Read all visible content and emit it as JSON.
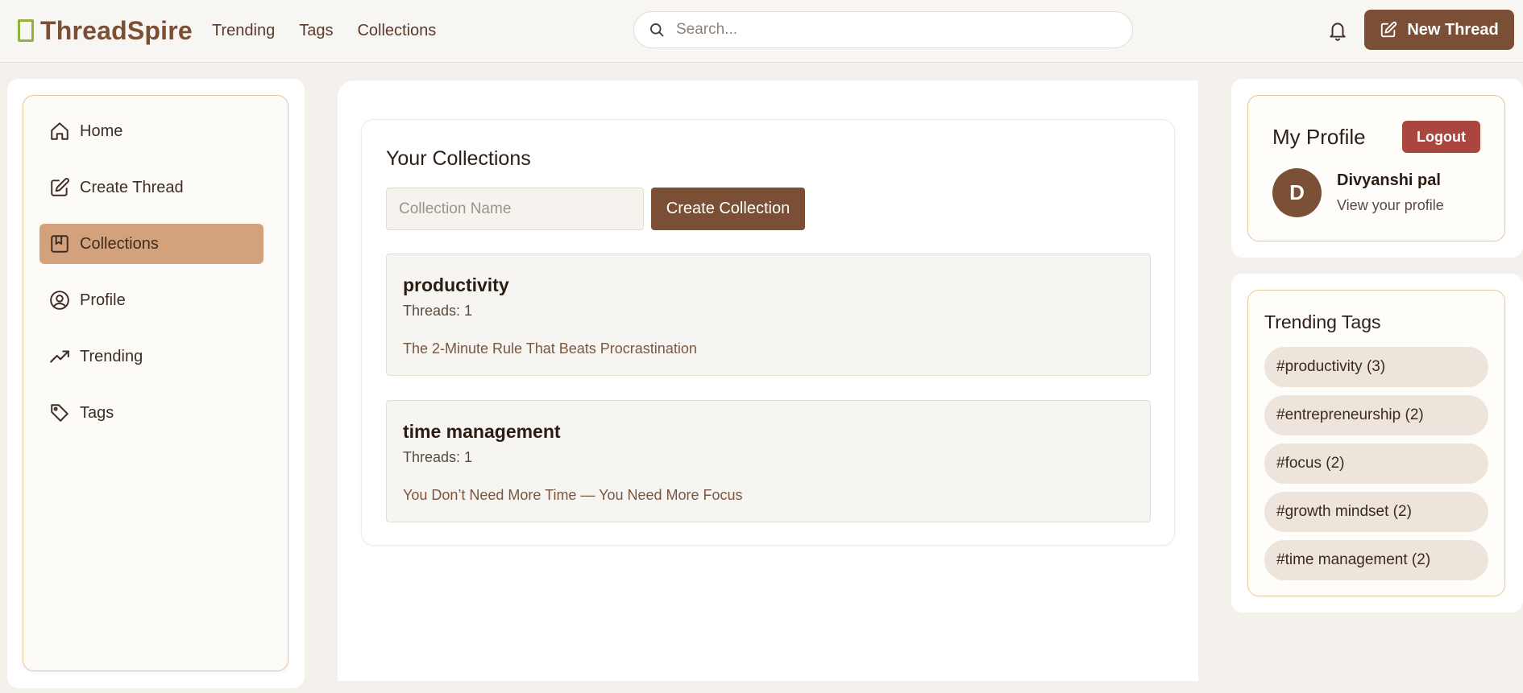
{
  "app": {
    "name": "ThreadSpire"
  },
  "topnav": {
    "items": [
      "Trending",
      "Tags",
      "Collections"
    ]
  },
  "search": {
    "placeholder": "Search..."
  },
  "header": {
    "new_thread_label": "New Thread"
  },
  "sidebar": {
    "items": [
      {
        "label": "Home",
        "icon": "home-icon"
      },
      {
        "label": "Create Thread",
        "icon": "edit-icon"
      },
      {
        "label": "Collections",
        "icon": "bookmark-icon",
        "active": true
      },
      {
        "label": "Profile",
        "icon": "user-circle-icon"
      },
      {
        "label": "Trending",
        "icon": "trending-up-icon"
      },
      {
        "label": "Tags",
        "icon": "tag-icon"
      }
    ]
  },
  "collections": {
    "title": "Your Collections",
    "input_placeholder": "Collection Name",
    "create_label": "Create Collection",
    "items": [
      {
        "name": "productivity",
        "count": "Threads: 1",
        "thread": "The 2-Minute Rule That Beats Procrastination"
      },
      {
        "name": "time management",
        "count": "Threads: 1",
        "thread": "You Don’t Need More Time — You Need More Focus"
      }
    ]
  },
  "profile": {
    "title": "My Profile",
    "logout_label": "Logout",
    "avatar_initial": "D",
    "user_name": "Divyanshi pal",
    "view_link": "View your profile"
  },
  "trending_tags": {
    "title": "Trending Tags",
    "items": [
      "#productivity (3)",
      "#entrepreneurship (2)",
      "#focus (2)",
      "#growth mindset (2)",
      "#time management (2)"
    ]
  },
  "colors": {
    "brand": "#7a4f35",
    "accent": "#7b4f36",
    "active_nav": "#d4a17d",
    "logout": "#a9473e",
    "logo_mark": "#8fb23a"
  }
}
